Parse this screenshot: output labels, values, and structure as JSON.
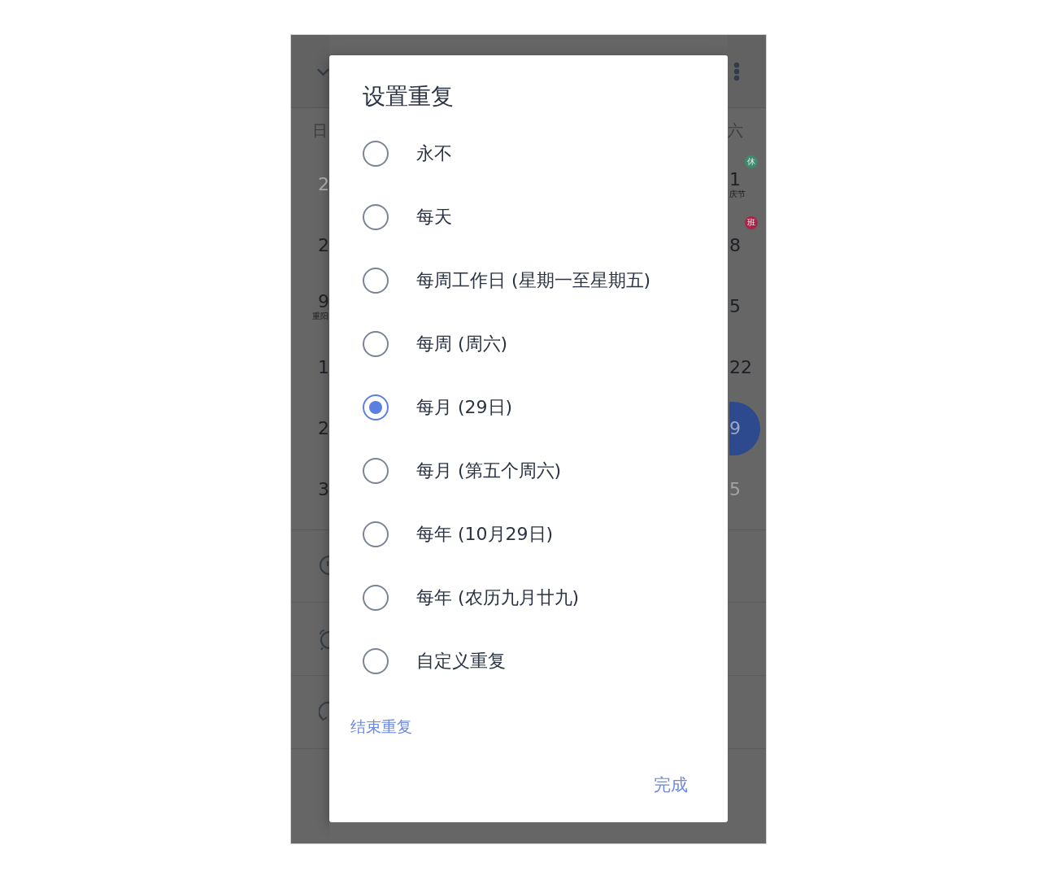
{
  "background": {
    "weekday_left": "日",
    "weekday_right": "六",
    "left_dates": [
      {
        "text": "2",
        "muted": true,
        "selected": false
      },
      {
        "text": "2",
        "muted": false,
        "selected": false
      },
      {
        "text": "9",
        "muted": false,
        "selected": false,
        "note": "重阳"
      },
      {
        "text": "1",
        "muted": false,
        "selected": false
      },
      {
        "text": "2",
        "muted": false,
        "selected": false
      },
      {
        "text": "3",
        "muted": false,
        "selected": false
      }
    ],
    "right_dates": [
      {
        "text": "1",
        "muted": false,
        "selected": false,
        "note": "庆节",
        "badge": {
          "text": "休",
          "color": "#3f8a6e"
        }
      },
      {
        "text": "8",
        "muted": false,
        "selected": false,
        "badge": {
          "text": "班",
          "color": "#a8244a"
        }
      },
      {
        "text": "5",
        "muted": false,
        "selected": false
      },
      {
        "text": "22",
        "muted": false,
        "selected": false
      },
      {
        "text": "9",
        "muted": false,
        "selected": true
      },
      {
        "text": "5",
        "muted": true,
        "selected": false
      }
    ]
  },
  "dialog": {
    "title": "设置重复",
    "options": [
      {
        "label": "永不",
        "selected": false
      },
      {
        "label": "每天",
        "selected": false
      },
      {
        "label": "每周工作日 (星期一至星期五)",
        "selected": false
      },
      {
        "label": "每周 (周六)",
        "selected": false
      },
      {
        "label": "每月 (29日)",
        "selected": true
      },
      {
        "label": "每月 (第五个周六)",
        "selected": false
      },
      {
        "label": "每年 (10月29日)",
        "selected": false
      },
      {
        "label": "每年 (农历九月廿九)",
        "selected": false
      },
      {
        "label": "自定义重复",
        "selected": false
      }
    ],
    "end_repeat": "结束重复",
    "done": "完成"
  }
}
